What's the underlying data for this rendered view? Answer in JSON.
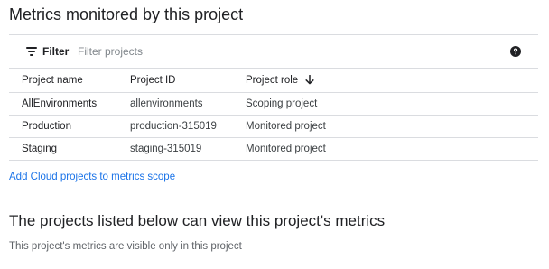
{
  "page": {
    "title": "Metrics monitored by this project"
  },
  "filter": {
    "label": "Filter",
    "placeholder": "Filter projects",
    "icon": "filter-list-icon",
    "help_icon": "help-icon"
  },
  "table": {
    "columns": [
      "Project name",
      "Project ID",
      "Project role"
    ],
    "sort_column": "Project role",
    "sort_direction": "descending",
    "rows": [
      {
        "name": "AllEnvironments",
        "id": "allenvironments",
        "role": "Scoping project"
      },
      {
        "name": "Production",
        "id": "production-315019",
        "role": "Monitored project"
      },
      {
        "name": "Staging",
        "id": "staging-315019",
        "role": "Monitored project"
      }
    ]
  },
  "actions": {
    "add_link": "Add Cloud projects to metrics scope"
  },
  "viewers": {
    "title": "The projects listed below can view this project's metrics",
    "note": "This project's metrics are visible only in this project"
  },
  "colors": {
    "link": "#1a73e8",
    "text": "#202124",
    "border": "#dadce0"
  }
}
